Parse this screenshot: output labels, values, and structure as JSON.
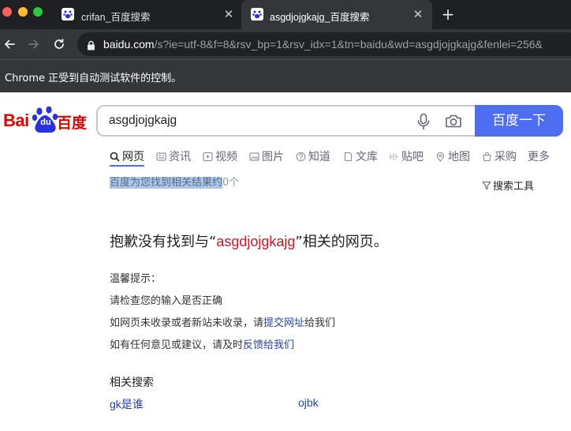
{
  "browser": {
    "tabs": [
      {
        "title": "crifan_百度搜索",
        "active": false
      },
      {
        "title": "asgdjojgkajg_百度搜索",
        "active": true
      }
    ],
    "close_glyph": "✕",
    "new_tab_glyph": "+",
    "url_host": "baidu.com",
    "url_path": "/s?ie=utf-8&f=8&rsv_bp=1&rsv_idx=1&tn=baidu&wd=asgdjojgkajg&fenlei=256&",
    "infobar_text": "Chrome 正受到自动测试软件的控制。"
  },
  "page": {
    "logo": {
      "bai": "Bai",
      "du": "du",
      "baidu_cn": "百度"
    },
    "search": {
      "value": "asgdjojgkajg",
      "button_label": "百度一下"
    },
    "nav_tabs": [
      {
        "label": "网页",
        "icon": "search-icon",
        "active": true
      },
      {
        "label": "资讯",
        "icon": "news-icon",
        "active": false
      },
      {
        "label": "视频",
        "icon": "video-icon",
        "active": false
      },
      {
        "label": "图片",
        "icon": "image-icon",
        "active": false
      },
      {
        "label": "知道",
        "icon": "question-icon",
        "active": false
      },
      {
        "label": "文库",
        "icon": "document-icon",
        "active": false
      },
      {
        "label": "贴吧",
        "icon": "tieba-icon",
        "active": false
      },
      {
        "label": "地图",
        "icon": "map-icon",
        "active": false
      },
      {
        "label": "采购",
        "icon": "shop-icon",
        "active": false
      },
      {
        "label": "更多",
        "icon": "",
        "active": false
      }
    ],
    "result_count": {
      "highlighted": "百度为您找到相关结果约",
      "rest": "0个"
    },
    "search_tools_label": "搜索工具",
    "no_result": {
      "prefix": "抱歉没有找到与“",
      "query": "asgdjojgkajg",
      "suffix": "”相关的网页。"
    },
    "tips": {
      "title": "温馨提示：",
      "line1": "请检查您的输入是否正确",
      "line2_prefix": "如网页未收录或者新站未收录，请",
      "line2_link": "提交网址",
      "line2_suffix": "给我们",
      "line3_prefix": "如有任何意见或建议，请及时",
      "line3_link": "反馈给我们"
    },
    "related": {
      "title": "相关搜索",
      "items": [
        "gk是谁",
        "ojbk"
      ]
    }
  },
  "colors": {
    "baidu_red": "#e10602",
    "baidu_blue": "#4e6ef2",
    "link_blue": "#2440b3",
    "query_red": "#c81623"
  }
}
